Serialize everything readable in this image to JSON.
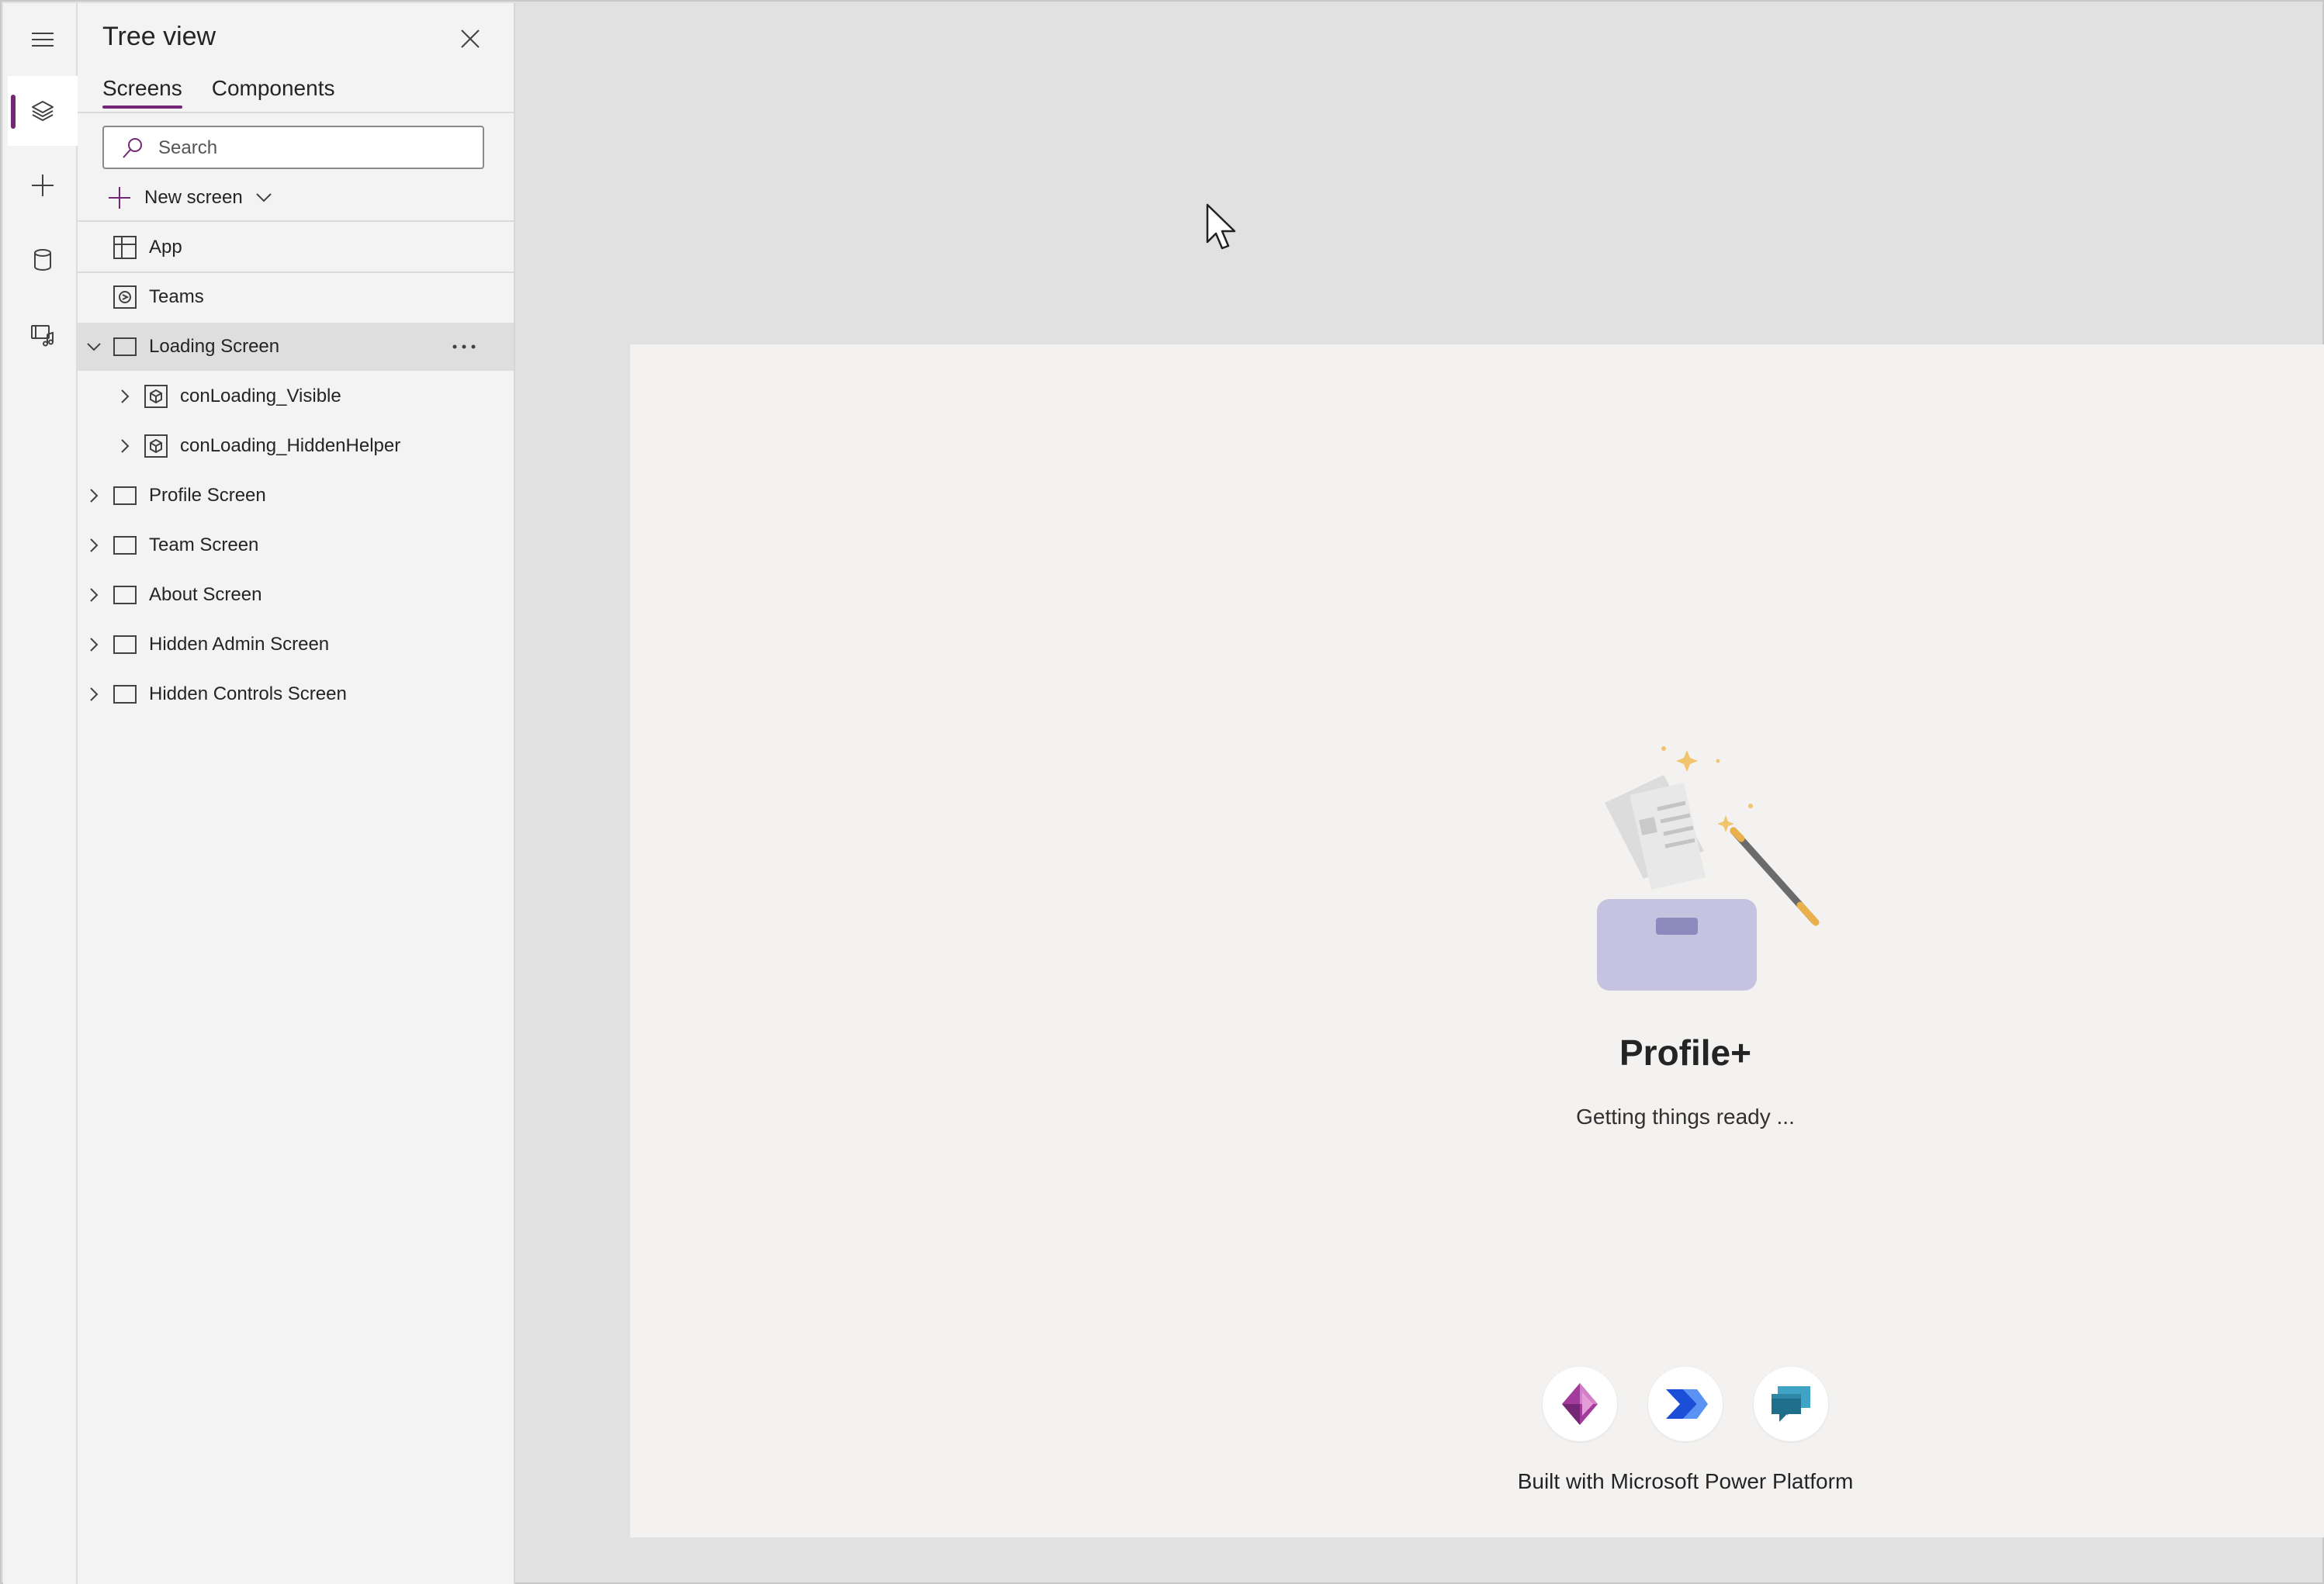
{
  "rail": {
    "items": [
      {
        "icon": "hamburger-menu-icon"
      },
      {
        "icon": "tree-view-layers-icon",
        "active": true
      },
      {
        "icon": "insert-plus-icon"
      },
      {
        "icon": "data-cylinder-icon"
      },
      {
        "icon": "media-icon"
      }
    ],
    "accent": "#742774"
  },
  "tree_view": {
    "title": "Tree view",
    "tabs": [
      {
        "label": "Screens",
        "active": true
      },
      {
        "label": "Components",
        "active": false
      }
    ],
    "search": {
      "placeholder": "Search",
      "value": ""
    },
    "new_screen_label": "New screen",
    "nodes": [
      {
        "label": "App",
        "icon": "app-grid-icon"
      },
      {
        "label": "Teams",
        "icon": "teams-icon"
      },
      {
        "label": "Loading Screen",
        "icon": "screen-icon",
        "expanded": true,
        "selected": true
      },
      {
        "label": "conLoading_Visible",
        "icon": "container-icon",
        "child": true
      },
      {
        "label": "conLoading_HiddenHelper",
        "icon": "container-icon",
        "child": true
      },
      {
        "label": "Profile Screen",
        "icon": "screen-icon"
      },
      {
        "label": "Team Screen",
        "icon": "screen-icon"
      },
      {
        "label": "About Screen",
        "icon": "screen-icon"
      },
      {
        "label": "Hidden Admin Screen",
        "icon": "screen-icon"
      },
      {
        "label": "Hidden Controls Screen",
        "icon": "screen-icon"
      }
    ]
  },
  "canvas": {
    "app_name": "Profile+",
    "status_text": "Getting things ready ...",
    "footer_text": "Built with Microsoft Power Platform",
    "logos": [
      "power-apps-icon",
      "power-automate-icon",
      "power-virtual-agents-icon"
    ]
  },
  "colors": {
    "accent": "#742774",
    "canvas_bg": "#f3f2f1",
    "workspace_bg": "#e1e1e1"
  }
}
